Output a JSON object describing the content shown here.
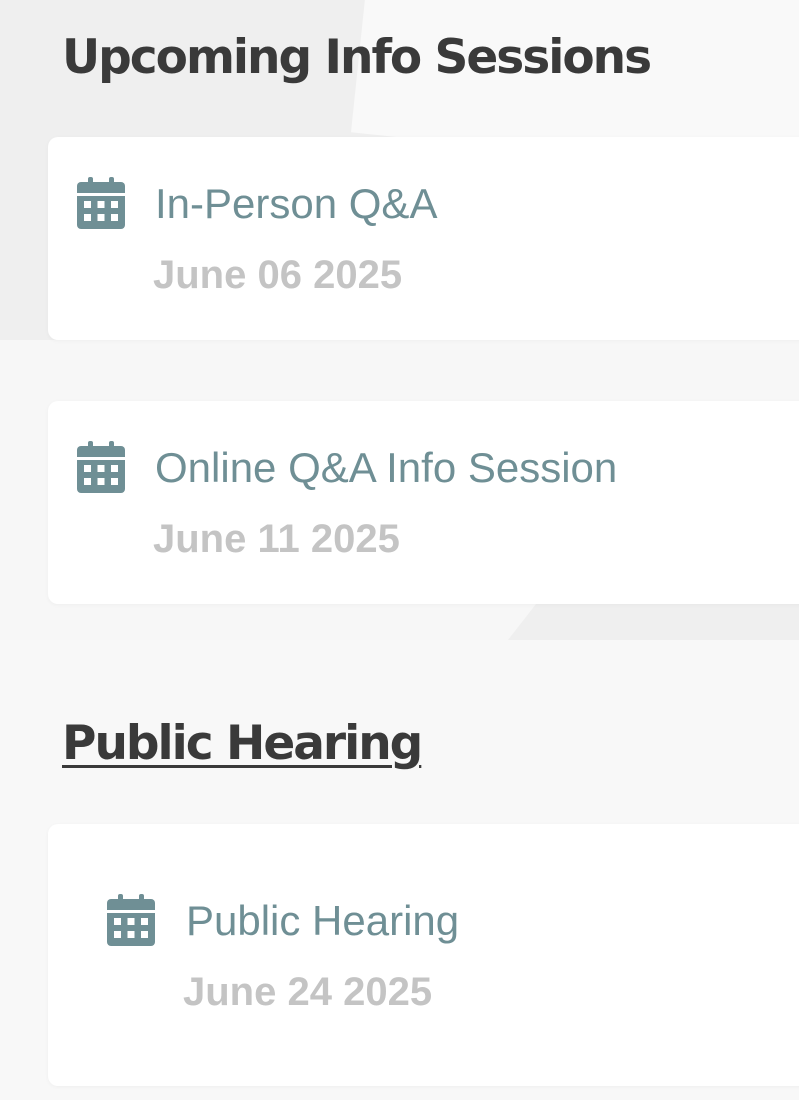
{
  "upcoming": {
    "heading": "Upcoming Info Sessions",
    "events": [
      {
        "title": "In-Person Q&A",
        "date": "June 06 2025",
        "icon": "calendar-icon"
      },
      {
        "title": "Online Q&A Info Session",
        "date": "June 11 2025",
        "icon": "calendar-icon"
      }
    ]
  },
  "hearing": {
    "heading": "Public Hearing",
    "events": [
      {
        "title": "Public Hearing",
        "date": "June 24 2025",
        "icon": "calendar-icon"
      }
    ]
  },
  "colors": {
    "heading": "#3a3a3a",
    "event_title": "#6f8f95",
    "event_date": "#c4c4c4",
    "icon": "#6f8f95",
    "card_background": "#ffffff",
    "page_background": "#f4f4f4"
  }
}
